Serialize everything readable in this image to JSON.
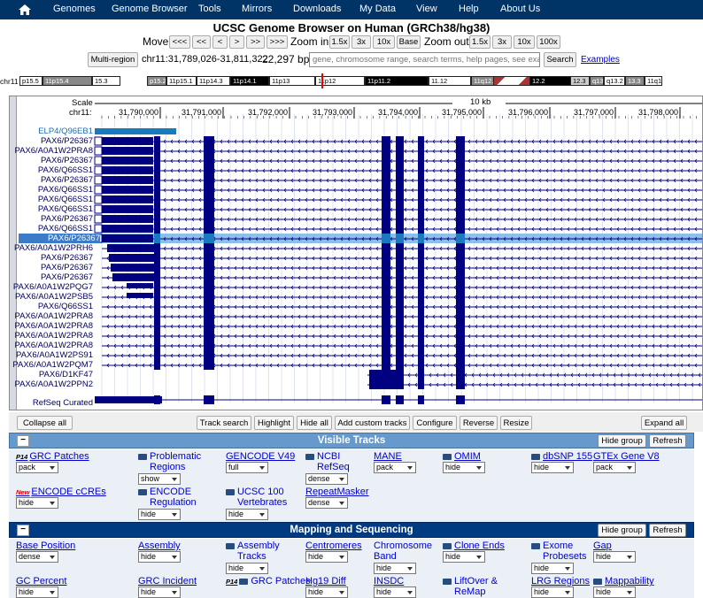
{
  "nav": {
    "home_icon": "home-icon",
    "items": [
      "Genomes",
      "Genome Browser",
      "Tools",
      "Mirrors",
      "Downloads",
      "My Data",
      "View",
      "Help",
      "About Us"
    ]
  },
  "title": "UCSC Genome Browser on Human (GRCh38/hg38)",
  "move": {
    "label": "Move",
    "buttons": [
      "<<<",
      "<<",
      "<",
      ">",
      ">>",
      ">>>"
    ],
    "zoom_in_label": "Zoom in",
    "zoom_in": [
      "1.5x",
      "3x",
      "10x",
      "Base"
    ],
    "zoom_out_label": "Zoom out",
    "zoom_out": [
      "1.5x",
      "3x",
      "10x",
      "100x"
    ]
  },
  "position": {
    "multiregion": "Multi-region",
    "coords": "chr11:31,789,026-31,811,322",
    "size": "22,297 bp.",
    "search_placeholder": "gene, chromosome range, search terms, help pages, see examples",
    "search_btn": "Search",
    "examples": "Examples"
  },
  "ideogram": {
    "label": "chr11 (p13)",
    "bands": [
      "p15.5",
      "11p15.4",
      "15.3",
      "p15.2",
      "11p15.1",
      "11p14.3",
      "11p14.1",
      "11p13",
      "11p12",
      "11p11.2",
      "11.12",
      "11q12.1",
      "12.2",
      "12.3",
      "q13.1",
      "q13.2",
      "13.3",
      "11q13.4"
    ]
  },
  "browser": {
    "scale_label": "Scale",
    "chr_label": "chr11:",
    "scale_bar": "10 kb",
    "ticks": [
      "31,790,000",
      "31,791,000",
      "31,792,000",
      "31,793,000",
      "31,794,000",
      "31,795,000",
      "31,796,000",
      "31,797,000",
      "31,798,000"
    ],
    "tracks": [
      "ELP4/Q96EB1",
      "PAX6/P26367",
      "PAX6/A0A1W2PRA8",
      "PAX6/P26367",
      "PAX6/Q66SS1",
      "PAX6/P26367",
      "PAX6/Q66SS1",
      "PAX6/Q66SS1",
      "PAX6/Q66SS1",
      "PAX6/P26367",
      "PAX6/Q66SS1",
      "PAX6/P26367",
      "PAX6/A0A1W2PRH6",
      "PAX6/P26367",
      "PAX6/P26367",
      "PAX6/P26367",
      "PAX6/A0A1W2PQG7",
      "PAX6/A0A1W2PSB5",
      "PAX6/Q66SS1",
      "PAX6/A0A1W2PRA8",
      "PAX6/A0A1W2PRA8",
      "PAX6/A0A1W2PRA8",
      "PAX6/A0A1W2PRA8",
      "PAX6/A0A1W2PS91",
      "PAX6/A0A1W2PQM7",
      "PAX6/D1KF47",
      "PAX6/A0A1W2PPN2"
    ],
    "refseq_label": "RefSeq Curated"
  },
  "controls": [
    "Collapse all",
    "Track search",
    "Highlight",
    "Hide all",
    "Add custom tracks",
    "Configure",
    "Reverse",
    "Resize",
    "Expand all"
  ],
  "visible_tracks": {
    "title": "Visible Tracks",
    "hide_group": "Hide group",
    "refresh": "Refresh",
    "items": [
      {
        "label": "GRC Patches",
        "badge": "P14",
        "mode": "pack"
      },
      {
        "label": "Problematic Regions",
        "mode": "show"
      },
      {
        "label": "GENCODE V49",
        "mode": "full"
      },
      {
        "label": "NCBI RefSeq",
        "mode": "dense"
      },
      {
        "label": "MANE",
        "mode": "pack"
      },
      {
        "label": "OMIM",
        "mode": "hide"
      },
      {
        "label": "dbSNP 155",
        "mode": "hide"
      },
      {
        "label": "GTEx Gene V8",
        "mode": "pack"
      },
      {
        "label": "ENCODE cCREs",
        "badge": "New",
        "mode": "hide"
      },
      {
        "label": "ENCODE Regulation",
        "mode": "hide"
      },
      {
        "label": "UCSC 100 Vertebrates",
        "mode": "hide"
      },
      {
        "label": "RepeatMasker",
        "mode": "dense"
      }
    ]
  },
  "mapping": {
    "title": "Mapping and Sequencing",
    "hide_group": "Hide group",
    "refresh": "Refresh",
    "items": [
      {
        "label": "Base Position",
        "mode": "dense"
      },
      {
        "label": "Assembly",
        "mode": "hide"
      },
      {
        "label": "Assembly Tracks",
        "mode": "hide"
      },
      {
        "label": "Centromeres",
        "mode": "hide"
      },
      {
        "label": "Chromosome Band",
        "mode": "hide"
      },
      {
        "label": "Clone Ends",
        "mode": "hide"
      },
      {
        "label": "Exome Probesets",
        "mode": "hide"
      },
      {
        "label": "Gap",
        "mode": "hide"
      },
      {
        "label": "GC Percent",
        "mode": "hide"
      },
      {
        "label": "GRC Incident",
        "mode": "hide"
      },
      {
        "label": "GRC Patches",
        "badge": "P14",
        "mode": "hide"
      },
      {
        "label": "Hg19 Diff",
        "mode": "hide"
      },
      {
        "label": "INSDC",
        "mode": "hide"
      },
      {
        "label": "LiftOver & ReMap",
        "mode": "hide"
      },
      {
        "label": "LRG Regions",
        "mode": "hide"
      },
      {
        "label": "Mappability",
        "mode": "hide"
      }
    ]
  }
}
